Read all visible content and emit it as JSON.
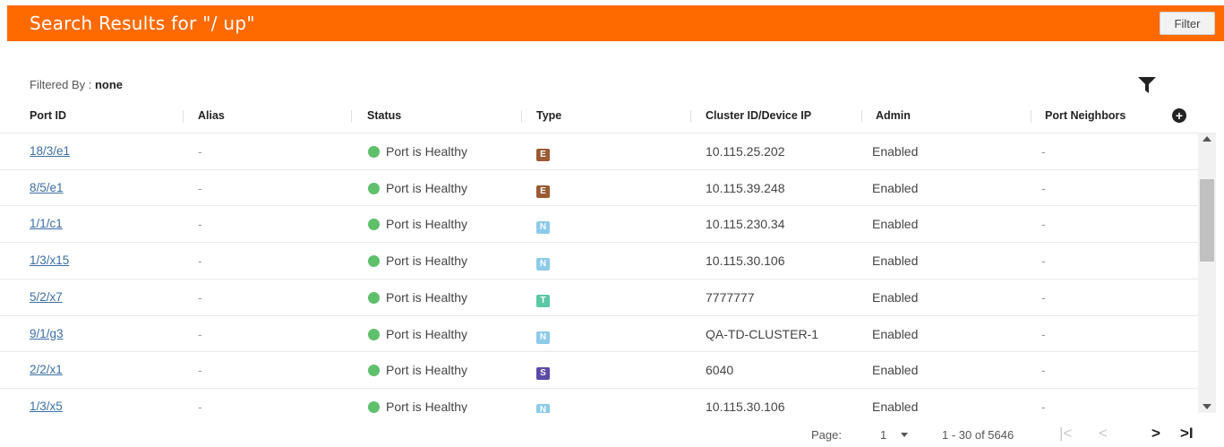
{
  "header": {
    "title": "Search Results for \"/ up\"",
    "filter_button": "Filter",
    "accent_color": "#ff6a00"
  },
  "filter_info": {
    "label": "Filtered By : ",
    "value": "none",
    "icon": "funnel-icon"
  },
  "columns": [
    "Port ID",
    "Alias",
    "Status",
    "Type",
    "Cluster ID/Device IP",
    "Admin",
    "Port Neighbors"
  ],
  "add_column_icon": "plus-circle-icon",
  "rows": [
    {
      "port_id": "18/3/e1",
      "alias": "-",
      "status": "Port is Healthy",
      "type": "E",
      "type_color": "#9a5a32",
      "cluster": "10.115.25.202",
      "admin": "Enabled",
      "neighbors": "-"
    },
    {
      "port_id": "8/5/e1",
      "alias": "-",
      "status": "Port is Healthy",
      "type": "E",
      "type_color": "#9a5a32",
      "cluster": "10.115.39.248",
      "admin": "Enabled",
      "neighbors": "-"
    },
    {
      "port_id": "1/1/c1",
      "alias": "-",
      "status": "Port is Healthy",
      "type": "N",
      "type_color": "#8ccbe9",
      "cluster": "10.115.230.34",
      "admin": "Enabled",
      "neighbors": "-"
    },
    {
      "port_id": "1/3/x15",
      "alias": "-",
      "status": "Port is Healthy",
      "type": "N",
      "type_color": "#8ccbe9",
      "cluster": "10.115.30.106",
      "admin": "Enabled",
      "neighbors": "-"
    },
    {
      "port_id": "5/2/x7",
      "alias": "-",
      "status": "Port is Healthy",
      "type": "T",
      "type_color": "#5cc7a4",
      "cluster": "7777777",
      "admin": "Enabled",
      "neighbors": "-"
    },
    {
      "port_id": "9/1/g3",
      "alias": "-",
      "status": "Port is Healthy",
      "type": "N",
      "type_color": "#8ccbe9",
      "cluster": "QA-TD-CLUSTER-1",
      "admin": "Enabled",
      "neighbors": "-"
    },
    {
      "port_id": "2/2/x1",
      "alias": "-",
      "status": "Port is Healthy",
      "type": "S",
      "type_color": "#5b4aa6",
      "cluster": "6040",
      "admin": "Enabled",
      "neighbors": "-"
    },
    {
      "port_id": "1/3/x5",
      "alias": "-",
      "status": "Port is Healthy",
      "type": "N",
      "type_color": "#8ccbe9",
      "cluster": "10.115.30.106",
      "admin": "Enabled",
      "neighbors": "-"
    }
  ],
  "status_color": "#5fbf6b",
  "pagination": {
    "page_label": "Page:",
    "page_value": "1",
    "range": "1 - 30 of 5646",
    "first": "|<",
    "prev": "<",
    "next": ">",
    "last": ">I"
  }
}
